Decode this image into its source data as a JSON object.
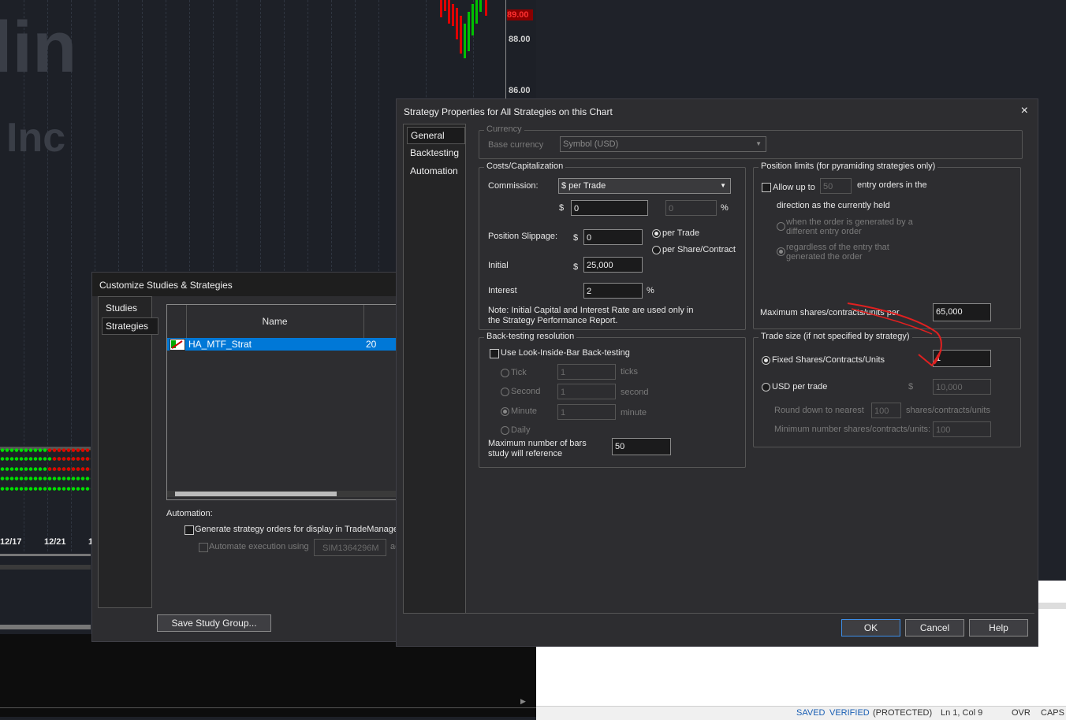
{
  "chart": {
    "watermark_1": "lin",
    "watermark_2": "Inc",
    "price_tag": "89.00",
    "price_88": "88.00",
    "price_86": "86.00",
    "date_1": "12/17",
    "date_2": "12/21",
    "date_3": "1"
  },
  "customize": {
    "title": "Customize Studies & Strategies",
    "nav": [
      "Studies",
      "Strategies"
    ],
    "table_header_name": "Name",
    "row_name": "HA_MTF_Strat",
    "row_value": "20",
    "automation_label": "Automation:",
    "generate_orders_label": "Generate strategy orders for display in TradeManage",
    "automate_label": "Automate execution using",
    "automate_account": "SIM1364296M",
    "automate_suffix": "ac",
    "save_group_button": "Save Study Group..."
  },
  "strategy": {
    "title": "Strategy Properties for All Strategies on this Chart",
    "close_icon": "×",
    "nav": [
      "General",
      "Backtesting",
      "Automation"
    ],
    "currency": {
      "group_label": "Currency",
      "base_label": "Base currency",
      "base_value": "Symbol (USD)"
    },
    "costs": {
      "group_label": "Costs/Capitalization",
      "commission_label": "Commission:",
      "commission_value": "$ per Trade",
      "dollar_sign": "$",
      "commission_amount": "0",
      "commission_pct": "0",
      "pct_sign": "%",
      "slippage_label": "Position Slippage:",
      "slippage_dollar": "$",
      "slippage_value": "0",
      "per_trade_label": "per Trade",
      "per_share_label": "per Share/Contract",
      "initial_label": "Initial",
      "initial_dollar": "$",
      "initial_value": "25,000",
      "interest_label": "Interest",
      "interest_value": "2",
      "interest_pct": "%",
      "note_line1": "Note: Initial Capital and Interest Rate are used only in",
      "note_line2": "the Strategy Performance Report."
    },
    "position_limits": {
      "group_label": "Position limits (for pyramiding strategies only)",
      "allow_label": "Allow up to",
      "allow_value": "50",
      "entry_orders_label": "entry orders in the",
      "direction_label": "direction as the currently held",
      "opt1_line1": "when the order is generated by a",
      "opt1_line2": "different entry order",
      "opt2_line1": "regardless of the entry that",
      "opt2_line2": "generated the order",
      "max_shares_label": "Maximum shares/contracts/units per",
      "max_shares_value": "65,000"
    },
    "backtesting": {
      "group_label": "Back-testing resolution",
      "lib_label": "Use Look-Inside-Bar Back-testing",
      "tick_label": "Tick",
      "tick_value": "1",
      "tick_unit": "ticks",
      "second_label": "Second",
      "second_value": "1",
      "second_unit": "second",
      "minute_label": "Minute",
      "minute_value": "1",
      "minute_unit": "minute",
      "daily_label": "Daily",
      "maxbars_line1": "Maximum number of bars",
      "maxbars_line2": "study will reference",
      "maxbars_value": "50"
    },
    "trade_size": {
      "group_label": "Trade size (if not specified by strategy)",
      "fixed_label": "Fixed Shares/Contracts/Units",
      "fixed_value": "1",
      "usd_label": "USD per trade",
      "usd_dollar": "$",
      "usd_value": "10,000",
      "round_label": "Round down to nearest",
      "round_value": "100",
      "round_unit": "shares/contracts/units",
      "min_label": "Minimum number shares/contracts/units:",
      "min_value": "100"
    },
    "buttons": {
      "ok": "OK",
      "cancel": "Cancel",
      "help": "Help"
    }
  },
  "statusbar": {
    "saved": "SAVED",
    "verified": "VERIFIED",
    "protected": "(PROTECTED)",
    "position": "Ln 1, Col 9",
    "ovr": "OVR",
    "caps": "CAPS"
  },
  "colors": {
    "accent": "#3d8ee8",
    "selected_row": "#0078d7",
    "annotation": "#e02020",
    "status_link": "#1a5fb4"
  }
}
